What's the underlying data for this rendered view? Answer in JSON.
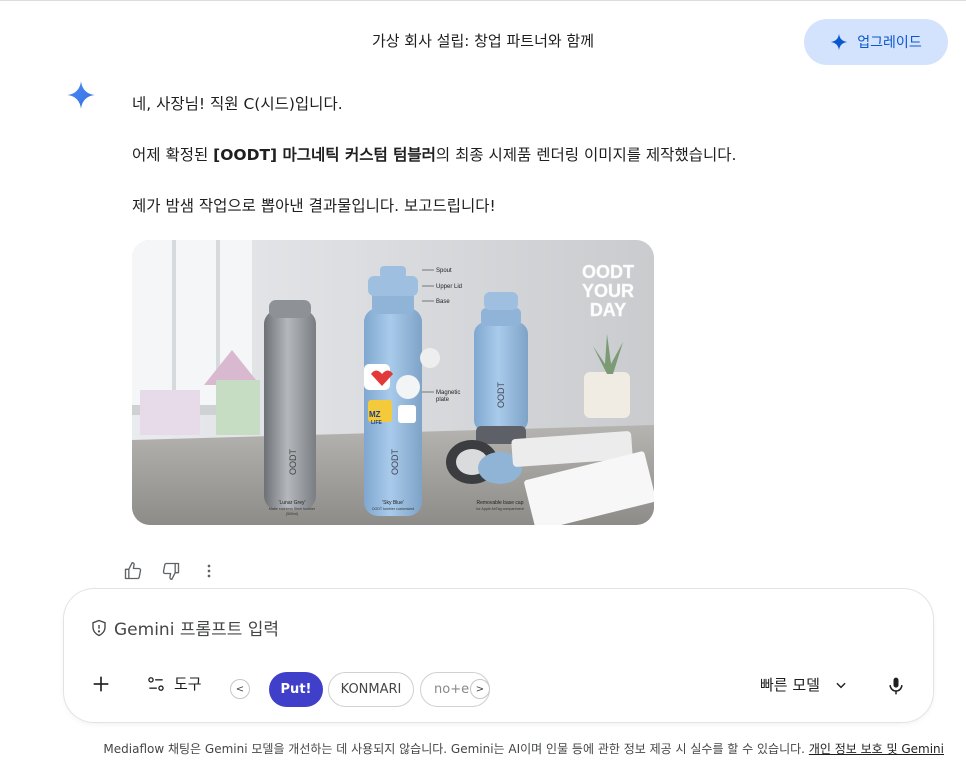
{
  "header": {
    "title": "가상 회사 설립: 창업 파트너와 함께",
    "upgrade_label": "업그레이드"
  },
  "response": {
    "line1": "네, 사장님! 직원 C(시드)입니다.",
    "line2_prefix": "어제 확정된 ",
    "line2_bold": "[OODT] 마그네틱 커스텀 텀블러",
    "line2_suffix": "의 최종 시제품 렌더링 이미지를 제작했습니다.",
    "line3": "제가 밤샘 작업으로 뽑아낸 결과물입니다. 보고드립니다!",
    "image": {
      "neon_text": [
        "OODT",
        "YOUR",
        "DAY"
      ],
      "callouts": [
        "Spout",
        "Upper Lid",
        "Base",
        "Magnetic",
        "plate"
      ],
      "bottle_brand": "OODT",
      "captions": [
        {
          "title": "'Lunar Grey'",
          "sub1": "Matte stainless Steel tumbler",
          "sub2": "(500ml)"
        },
        {
          "title": "'Sky Blue'",
          "sub1": "OODT tumbler customized",
          "sub2": ""
        },
        {
          "title": "Removable base cap",
          "sub1": "for Apple AirTag compartment",
          "sub2": ""
        }
      ],
      "sticker_text": [
        "MZ",
        "LIFE"
      ]
    }
  },
  "actions": {
    "icons": [
      "thumbs-up-icon",
      "thumbs-down-icon",
      "more-vert-icon"
    ]
  },
  "composer": {
    "placeholder": "Gemini 프롬프트 입력",
    "tools_label": "도구",
    "chips": [
      "Put!",
      "KONMARI",
      "no+e"
    ],
    "scroll_left": "<",
    "scroll_right": ">",
    "model_label": "빠른 모델"
  },
  "footer": {
    "text": "Mediaflow 채팅은 Gemini 모델을 개선하는 데 사용되지 않습니다. Gemini는 AI이며 인물 등에 관한 정보 제공 시 실수를 할 수 있습니다. ",
    "link": "개인 정보 보호 및 Gemini"
  },
  "colors": {
    "accent": "#0b57d0",
    "upgrade_bg": "#d3e3fd",
    "chip_active": "#3f3fc9",
    "bottle_blue": "#9fc3e6",
    "bottle_grey": "#9a9ea2"
  }
}
